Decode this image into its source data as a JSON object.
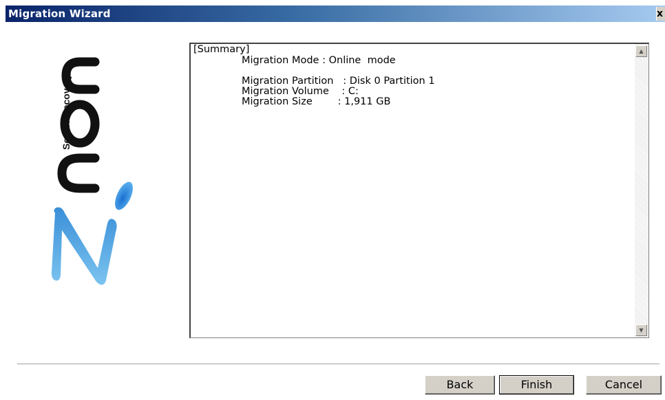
{
  "window": {
    "title": "Migration Wizard",
    "close_label": "x"
  },
  "logo": {
    "tagline": "Server Recovery",
    "brand": "ZiCon"
  },
  "summary": {
    "heading": "[Summary]",
    "mode_line": "Migration Mode : Online  mode",
    "partition_line": "Migration Partition   : Disk 0 Partition 1",
    "volume_line": "Migration Volume    : C:",
    "size_line": "Migration Size        : 1,911 GB"
  },
  "buttons": {
    "back": "Back",
    "finish": "Finish",
    "cancel": "Cancel"
  },
  "colors": {
    "title_start": "#0a246a",
    "title_end": "#a6caf0",
    "logo_blue": "#3a9be0",
    "logo_dark": "#111111"
  }
}
